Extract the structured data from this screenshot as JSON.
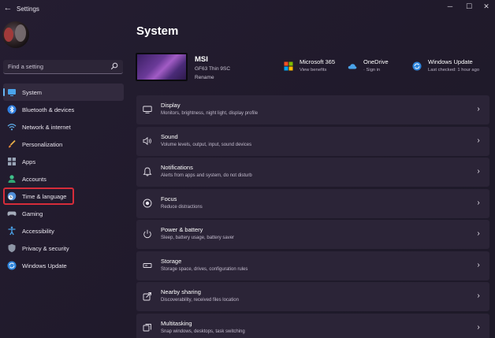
{
  "window": {
    "title": "Settings",
    "back_glyph": "←",
    "min_glyph": "─",
    "max_glyph": "☐",
    "close_glyph": "✕"
  },
  "search": {
    "placeholder": "Find a setting"
  },
  "sidebar": {
    "items": [
      {
        "label": "System",
        "icon": "system-icon",
        "active": true
      },
      {
        "label": "Bluetooth & devices",
        "icon": "bluetooth-icon"
      },
      {
        "label": "Network & internet",
        "icon": "wifi-icon"
      },
      {
        "label": "Personalization",
        "icon": "brush-icon"
      },
      {
        "label": "Apps",
        "icon": "apps-icon"
      },
      {
        "label": "Accounts",
        "icon": "person-icon"
      },
      {
        "label": "Time & language",
        "icon": "globe-clock-icon",
        "highlighted": true
      },
      {
        "label": "Gaming",
        "icon": "gamepad-icon"
      },
      {
        "label": "Accessibility",
        "icon": "accessibility-icon"
      },
      {
        "label": "Privacy & security",
        "icon": "shield-icon"
      },
      {
        "label": "Windows Update",
        "icon": "update-icon"
      }
    ]
  },
  "page": {
    "title": "System"
  },
  "device": {
    "name": "MSI",
    "model": "GF63 Thin 9SC",
    "rename_label": "Rename"
  },
  "quick_links": [
    {
      "title": "Microsoft 365",
      "subtitle": "View benefits",
      "icon": "microsoft-logo-icon"
    },
    {
      "title": "OneDrive",
      "subtitle": "· Sign in",
      "icon": "cloud-icon"
    },
    {
      "title": "Windows Update",
      "subtitle": "Last checked: 1 hour ago",
      "icon": "update-icon"
    }
  ],
  "cards": [
    {
      "title": "Display",
      "subtitle": "Monitors, brightness, night light, display profile",
      "icon": "monitor-icon"
    },
    {
      "title": "Sound",
      "subtitle": "Volume levels, output, input, sound devices",
      "icon": "speaker-icon"
    },
    {
      "title": "Notifications",
      "subtitle": "Alerts from apps and system, do not disturb",
      "icon": "bell-icon"
    },
    {
      "title": "Focus",
      "subtitle": "Reduce distractions",
      "icon": "focus-icon"
    },
    {
      "title": "Power & battery",
      "subtitle": "Sleep, battery usage, battery saver",
      "icon": "power-icon"
    },
    {
      "title": "Storage",
      "subtitle": "Storage space, drives, configuration rules",
      "icon": "storage-icon"
    },
    {
      "title": "Nearby sharing",
      "subtitle": "Discoverability, received files location",
      "icon": "share-icon"
    },
    {
      "title": "Multitasking",
      "subtitle": "Snap windows, desktops, task switching",
      "icon": "multitask-icon"
    }
  ],
  "chevron_glyph": "›",
  "colors": {
    "accent": "#68b5f2",
    "highlight_outline": "#d62c3a",
    "card_bg": "#2b2437",
    "window_bg": "#221c2e"
  }
}
